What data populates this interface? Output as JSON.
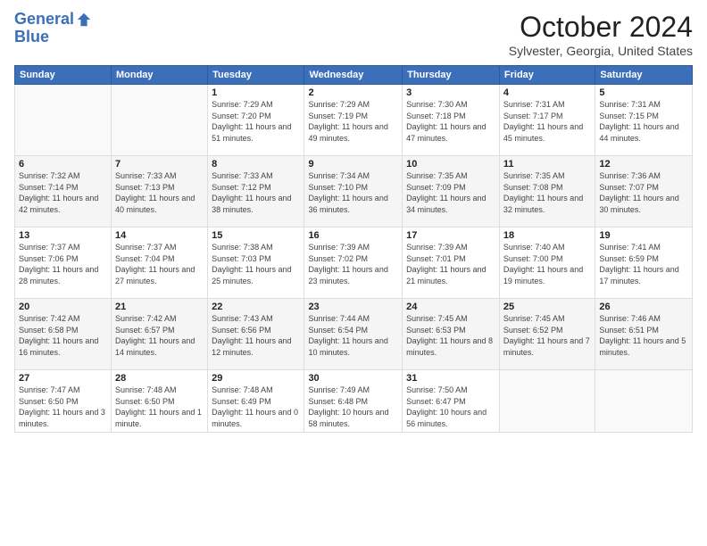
{
  "logo": {
    "line1": "General",
    "line2": "Blue"
  },
  "title": "October 2024",
  "location": "Sylvester, Georgia, United States",
  "days_of_week": [
    "Sunday",
    "Monday",
    "Tuesday",
    "Wednesday",
    "Thursday",
    "Friday",
    "Saturday"
  ],
  "weeks": [
    [
      {
        "num": "",
        "info": ""
      },
      {
        "num": "",
        "info": ""
      },
      {
        "num": "1",
        "info": "Sunrise: 7:29 AM\nSunset: 7:20 PM\nDaylight: 11 hours and 51 minutes."
      },
      {
        "num": "2",
        "info": "Sunrise: 7:29 AM\nSunset: 7:19 PM\nDaylight: 11 hours and 49 minutes."
      },
      {
        "num": "3",
        "info": "Sunrise: 7:30 AM\nSunset: 7:18 PM\nDaylight: 11 hours and 47 minutes."
      },
      {
        "num": "4",
        "info": "Sunrise: 7:31 AM\nSunset: 7:17 PM\nDaylight: 11 hours and 45 minutes."
      },
      {
        "num": "5",
        "info": "Sunrise: 7:31 AM\nSunset: 7:15 PM\nDaylight: 11 hours and 44 minutes."
      }
    ],
    [
      {
        "num": "6",
        "info": "Sunrise: 7:32 AM\nSunset: 7:14 PM\nDaylight: 11 hours and 42 minutes."
      },
      {
        "num": "7",
        "info": "Sunrise: 7:33 AM\nSunset: 7:13 PM\nDaylight: 11 hours and 40 minutes."
      },
      {
        "num": "8",
        "info": "Sunrise: 7:33 AM\nSunset: 7:12 PM\nDaylight: 11 hours and 38 minutes."
      },
      {
        "num": "9",
        "info": "Sunrise: 7:34 AM\nSunset: 7:10 PM\nDaylight: 11 hours and 36 minutes."
      },
      {
        "num": "10",
        "info": "Sunrise: 7:35 AM\nSunset: 7:09 PM\nDaylight: 11 hours and 34 minutes."
      },
      {
        "num": "11",
        "info": "Sunrise: 7:35 AM\nSunset: 7:08 PM\nDaylight: 11 hours and 32 minutes."
      },
      {
        "num": "12",
        "info": "Sunrise: 7:36 AM\nSunset: 7:07 PM\nDaylight: 11 hours and 30 minutes."
      }
    ],
    [
      {
        "num": "13",
        "info": "Sunrise: 7:37 AM\nSunset: 7:06 PM\nDaylight: 11 hours and 28 minutes."
      },
      {
        "num": "14",
        "info": "Sunrise: 7:37 AM\nSunset: 7:04 PM\nDaylight: 11 hours and 27 minutes."
      },
      {
        "num": "15",
        "info": "Sunrise: 7:38 AM\nSunset: 7:03 PM\nDaylight: 11 hours and 25 minutes."
      },
      {
        "num": "16",
        "info": "Sunrise: 7:39 AM\nSunset: 7:02 PM\nDaylight: 11 hours and 23 minutes."
      },
      {
        "num": "17",
        "info": "Sunrise: 7:39 AM\nSunset: 7:01 PM\nDaylight: 11 hours and 21 minutes."
      },
      {
        "num": "18",
        "info": "Sunrise: 7:40 AM\nSunset: 7:00 PM\nDaylight: 11 hours and 19 minutes."
      },
      {
        "num": "19",
        "info": "Sunrise: 7:41 AM\nSunset: 6:59 PM\nDaylight: 11 hours and 17 minutes."
      }
    ],
    [
      {
        "num": "20",
        "info": "Sunrise: 7:42 AM\nSunset: 6:58 PM\nDaylight: 11 hours and 16 minutes."
      },
      {
        "num": "21",
        "info": "Sunrise: 7:42 AM\nSunset: 6:57 PM\nDaylight: 11 hours and 14 minutes."
      },
      {
        "num": "22",
        "info": "Sunrise: 7:43 AM\nSunset: 6:56 PM\nDaylight: 11 hours and 12 minutes."
      },
      {
        "num": "23",
        "info": "Sunrise: 7:44 AM\nSunset: 6:54 PM\nDaylight: 11 hours and 10 minutes."
      },
      {
        "num": "24",
        "info": "Sunrise: 7:45 AM\nSunset: 6:53 PM\nDaylight: 11 hours and 8 minutes."
      },
      {
        "num": "25",
        "info": "Sunrise: 7:45 AM\nSunset: 6:52 PM\nDaylight: 11 hours and 7 minutes."
      },
      {
        "num": "26",
        "info": "Sunrise: 7:46 AM\nSunset: 6:51 PM\nDaylight: 11 hours and 5 minutes."
      }
    ],
    [
      {
        "num": "27",
        "info": "Sunrise: 7:47 AM\nSunset: 6:50 PM\nDaylight: 11 hours and 3 minutes."
      },
      {
        "num": "28",
        "info": "Sunrise: 7:48 AM\nSunset: 6:50 PM\nDaylight: 11 hours and 1 minute."
      },
      {
        "num": "29",
        "info": "Sunrise: 7:48 AM\nSunset: 6:49 PM\nDaylight: 11 hours and 0 minutes."
      },
      {
        "num": "30",
        "info": "Sunrise: 7:49 AM\nSunset: 6:48 PM\nDaylight: 10 hours and 58 minutes."
      },
      {
        "num": "31",
        "info": "Sunrise: 7:50 AM\nSunset: 6:47 PM\nDaylight: 10 hours and 56 minutes."
      },
      {
        "num": "",
        "info": ""
      },
      {
        "num": "",
        "info": ""
      }
    ]
  ]
}
